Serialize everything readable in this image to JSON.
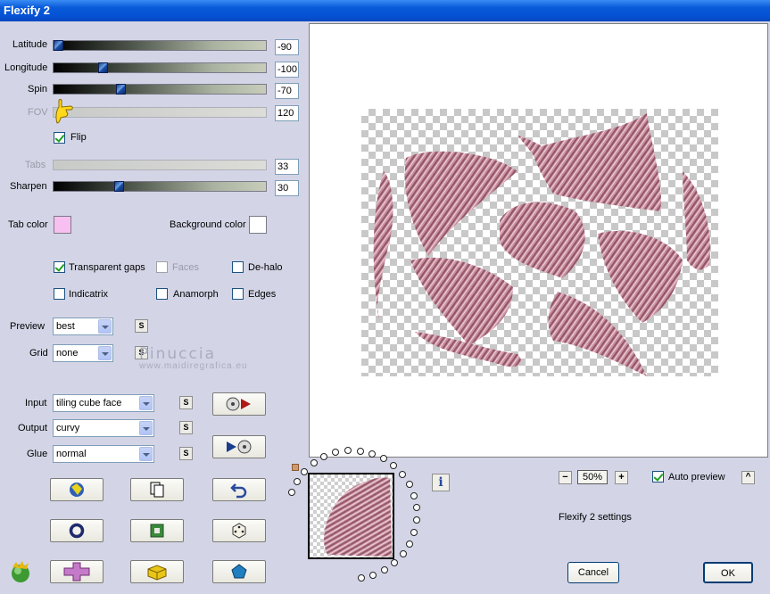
{
  "window": {
    "title": "Flexify 2"
  },
  "sliders": {
    "latitude": {
      "label": "Latitude",
      "value": "-90"
    },
    "longitude": {
      "label": "Longitude",
      "value": "-100"
    },
    "spin": {
      "label": "Spin",
      "value": "-70"
    },
    "fov": {
      "label": "FOV",
      "value": "120"
    },
    "tabs": {
      "label": "Tabs",
      "value": "33"
    },
    "sharpen": {
      "label": "Sharpen",
      "value": "30"
    }
  },
  "flip": {
    "label": "Flip",
    "checked": true
  },
  "colors": {
    "tab_color_label": "Tab color",
    "tab_color": "#f8c0f0",
    "background_color_label": "Background color",
    "background_color": "#ffffff"
  },
  "options": {
    "transparent_gaps": "Transparent gaps",
    "faces": "Faces",
    "de_halo": "De-halo",
    "indicatrix": "Indicatrix",
    "anamorph": "Anamorph",
    "edges": "Edges"
  },
  "selects": {
    "preview": {
      "label": "Preview",
      "value": "best"
    },
    "grid": {
      "label": "Grid",
      "value": "none"
    },
    "input": {
      "label": "Input",
      "value": "tiling cube face"
    },
    "output": {
      "label": "Output",
      "value": "curvy"
    },
    "glue": {
      "label": "Glue",
      "value": "normal"
    }
  },
  "small_button_label": "S",
  "watermark": {
    "name": "Pinuccia",
    "site": "www.maidiregrafica.eu"
  },
  "zoom": {
    "value": "50%",
    "minus": "−",
    "plus": "+"
  },
  "auto_preview": {
    "label": "Auto preview",
    "checked": true,
    "toggle": "^"
  },
  "settings_name": "Flexify 2 settings",
  "buttons": {
    "cancel": "Cancel",
    "ok": "OK"
  },
  "info_label": "i"
}
